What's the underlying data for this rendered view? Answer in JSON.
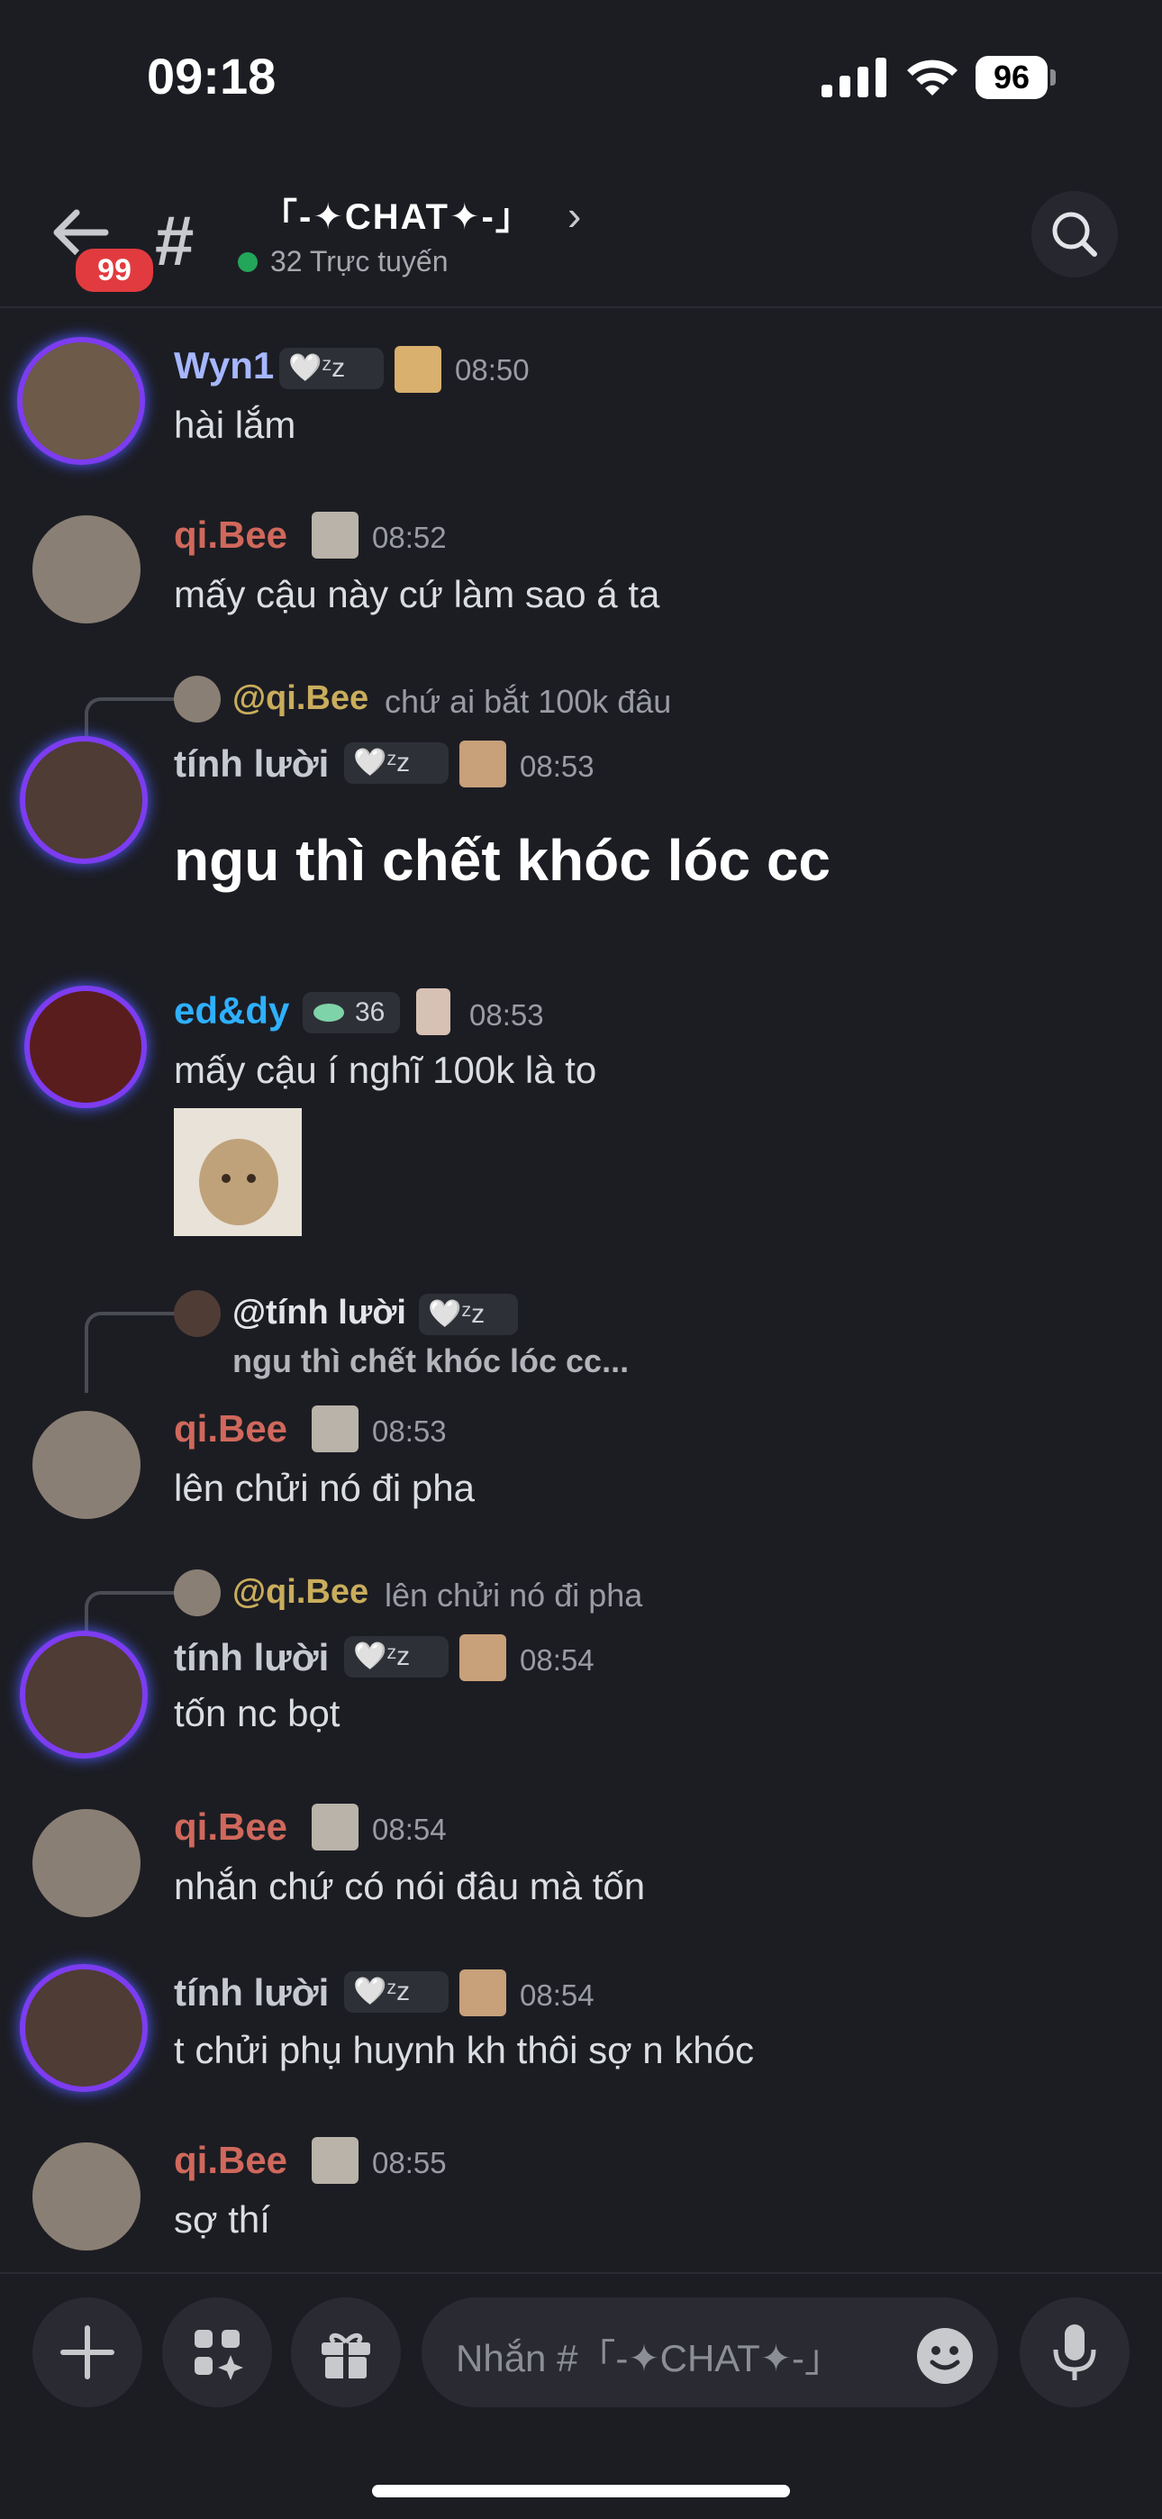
{
  "status_bar": {
    "time": "09:18",
    "battery": "96"
  },
  "header": {
    "badge_count": "99",
    "channel_name": "「-✦CHAT✦-」",
    "online": "32 Trực tuyến"
  },
  "messages": [
    {
      "user": "Wyn1",
      "tag": "🤍ᶻz",
      "time": "08:50",
      "text": "hài lắm"
    },
    {
      "user": "qi.Bee",
      "time": "08:52",
      "text": "mấy cậu này cứ làm sao á ta"
    },
    {
      "reply_user": "@qi.Bee",
      "reply_text": "chứ ai bắt 100k đâu",
      "user": "tính lười",
      "tag": "🤍ᶻz",
      "time": "08:53",
      "text": "ngu thì chết khóc lóc cc"
    },
    {
      "user": "ed&dy",
      "tag": "36",
      "time": "08:53",
      "text": "mấy cậu í nghĩ 100k là to"
    },
    {
      "reply_user": "@tính lười",
      "reply_tag": "🤍ᶻz",
      "reply_text": "ngu thì chết khóc lóc cc...",
      "user": "qi.Bee",
      "time": "08:53",
      "text": "lên chửi nó đi pha"
    },
    {
      "reply_user": "@qi.Bee",
      "reply_text": "lên chửi nó đi pha",
      "user": "tính lười",
      "tag": "🤍ᶻz",
      "time": "08:54",
      "text": "tốn nc bọt"
    },
    {
      "user": "qi.Bee",
      "time": "08:54",
      "text": "nhắn chứ có nói đâu mà tốn"
    },
    {
      "user": "tính lười",
      "tag": "🤍ᶻz",
      "time": "08:54",
      "text": "t chửi phụ huynh kh thôi sợ n khóc"
    },
    {
      "user": "qi.Bee",
      "time": "08:55",
      "text": "sợ thí"
    }
  ],
  "composer": {
    "placeholder": "Nhắn #「-✦CHAT✦-」"
  },
  "icons": [
    "back-arrow-icon",
    "hash-icon",
    "chevron-right-icon",
    "search-icon",
    "plus-icon",
    "apps-icon",
    "gift-icon",
    "emoji-icon",
    "mic-icon"
  ],
  "colors": {
    "background": "#1c1d23",
    "badge": "#e23b3f",
    "online": "#23a55a"
  }
}
